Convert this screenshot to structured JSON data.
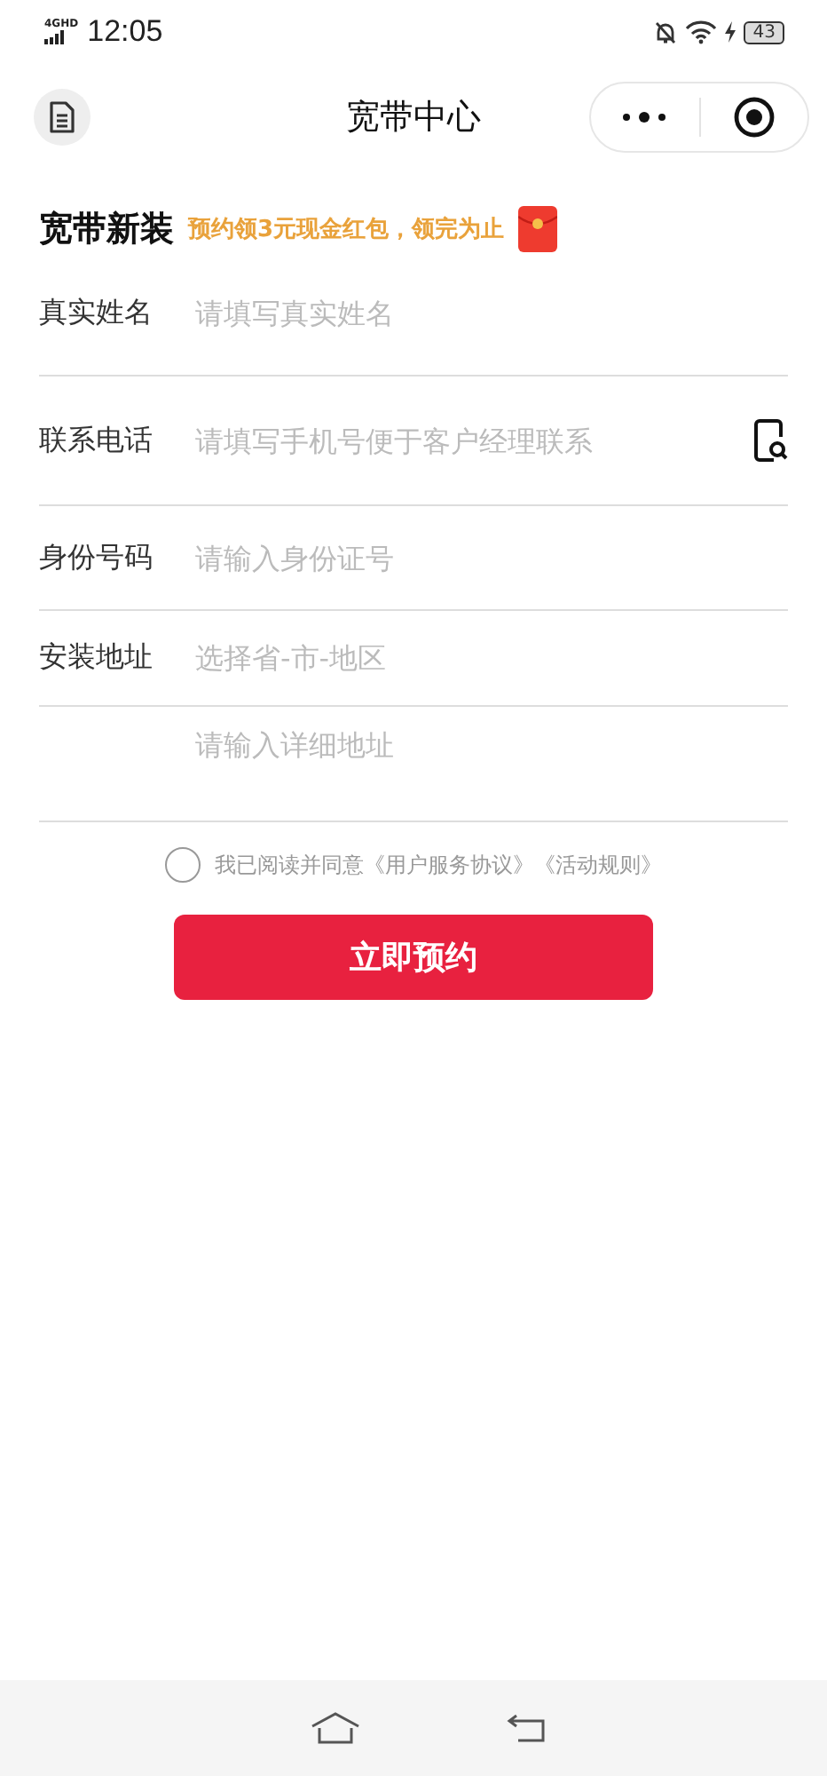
{
  "status_bar": {
    "network": "4GHD",
    "time": "12:05",
    "battery": "43"
  },
  "nav": {
    "title": "宽带中心"
  },
  "promo": {
    "title": "宽带新装",
    "note": "预约领3元现金红包，领完为止"
  },
  "fields": [
    {
      "kind": "text",
      "label": "真实姓名",
      "placeholder": "请填写真实姓名"
    },
    {
      "kind": "contact",
      "label": "联系电话",
      "placeholder": "请填写手机号便于客户经理联系"
    },
    {
      "kind": "text",
      "label": "身份号码",
      "placeholder": "请输入身份证号"
    },
    {
      "kind": "select",
      "label": "安装地址",
      "placeholder": "选择省-市-地区"
    },
    {
      "kind": "text",
      "placeholder": "请输入详细地址"
    }
  ],
  "agreement": {
    "checked": false,
    "text": "我已阅读并同意",
    "links": [
      "《用户服务协议》",
      "《活动规则》"
    ]
  },
  "submit": "立即预约"
}
